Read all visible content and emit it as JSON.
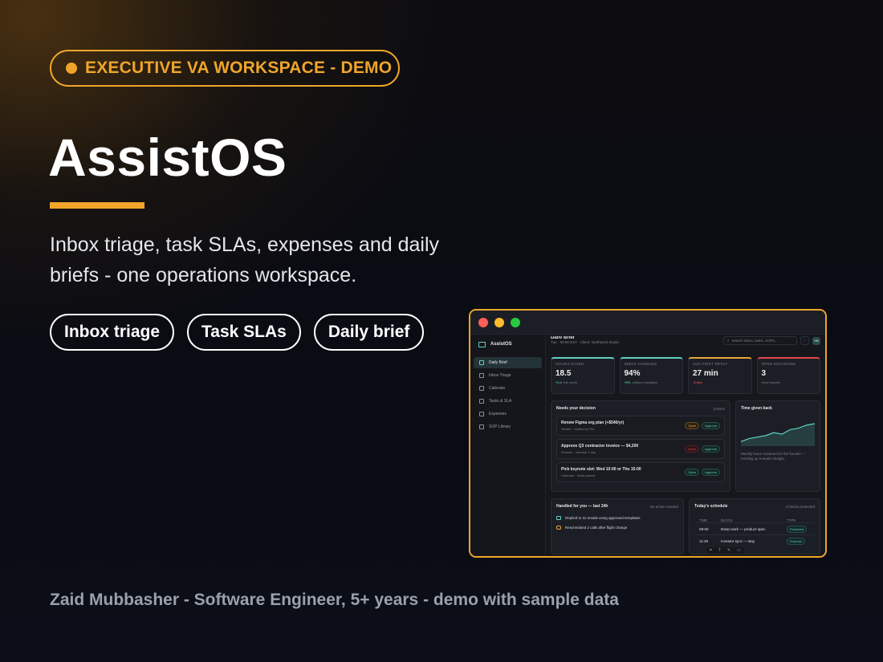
{
  "hero": {
    "badge": "EXECUTIVE VA WORKSPACE - DEMO",
    "title": "AssistOS",
    "subtitle": "Inbox triage, task SLAs, expenses and daily briefs - one operations workspace.",
    "chips": [
      "Inbox triage",
      "Task SLAs",
      "Daily brief"
    ],
    "footer": "Zaid Mubbasher  -  Software Engineer, 5+ years  -  demo with sample data"
  },
  "colors": {
    "accent": "#f0a52a",
    "teal": "#5fd0c4"
  },
  "app": {
    "brand": "AssistOS",
    "nav": [
      {
        "label": "Daily Brief",
        "icon": "clipboard-icon",
        "active": true
      },
      {
        "label": "Inbox Triage",
        "icon": "inbox-icon"
      },
      {
        "label": "Calendar",
        "icon": "calendar-icon"
      },
      {
        "label": "Tasks & SLA",
        "icon": "checkbox-icon"
      },
      {
        "label": "Expenses",
        "icon": "receipt-icon"
      },
      {
        "label": "SOP Library",
        "icon": "book-icon"
      }
    ],
    "header": {
      "title": "Daily Brief",
      "subtitle": "Tue · 09:00 EST · Client: Northwind Studio",
      "search_placeholder": "Search inbox, tasks, SOPs...",
      "avatar": "HB"
    },
    "kpis": [
      {
        "label": "HOURS SAVED",
        "value": "18.5",
        "delta": "+2.4",
        "note": "this week",
        "trend": "up",
        "color": "#5fd0c4"
      },
      {
        "label": "INBOX HANDLED",
        "value": "94%",
        "delta": "+6%",
        "note": "without escalation",
        "trend": "up",
        "color": "#5fd0c4"
      },
      {
        "label": "AVG FIRST REPLY",
        "value": "27 min",
        "delta": "-9 min",
        "note": "",
        "trend": "down",
        "color": "#e7a63a"
      },
      {
        "label": "OPEN DECISIONS",
        "value": "3",
        "delta": "",
        "note": "need founder",
        "trend": "none",
        "color": "#e5484d"
      }
    ],
    "decisions": {
      "title": "Needs your decision",
      "count": "3 items",
      "items": [
        {
          "title": "Renew Figma org plan (+$540/yr)",
          "sub": "Vendor · replied by Thu",
          "status": "Open",
          "status_style": "amber",
          "action": "Approve"
        },
        {
          "title": "Approve Q3 contractor invoice — $4,200",
          "sub": "Finance · overdue 1 day",
          "status": "Open",
          "status_style": "red",
          "action": "Approve"
        },
        {
          "title": "Pick keynote slot: Wed 10:00 or Thu 15:00",
          "sub": "Calendar · holds placed",
          "status": "Open",
          "status_style": "teal",
          "action": "Approve"
        }
      ]
    },
    "time_back": {
      "title": "Time given back",
      "caption": "Weekly hours reclaimed for the founder — trending up 9 weeks straight.",
      "points": [
        3,
        4,
        4.5,
        5,
        6,
        5.5,
        7,
        7.5,
        8.5,
        9
      ]
    },
    "handled": {
      "title": "Handled for you — last 24h",
      "meta": "No action needed",
      "items": [
        {
          "icon": "mail-icon",
          "text": "Replied to 31 emails using approved templates"
        },
        {
          "icon": "phone-icon",
          "text": "Rescheduled 2 calls after flight change"
        }
      ]
    },
    "schedule": {
      "title": "Today's schedule",
      "meta": "4 blocks protected",
      "columns": [
        "TIME",
        "BLOCK",
        "TYPE"
      ],
      "rows": [
        {
          "time": "09:00",
          "block": "Deep work — product spec",
          "type": "Protected"
        },
        {
          "time": "11:30",
          "block": "Investor sync — Bay",
          "type": "External"
        }
      ]
    },
    "toolbar_icons": [
      "crop-icon",
      "text-icon",
      "pen-icon",
      "comment-icon"
    ]
  }
}
